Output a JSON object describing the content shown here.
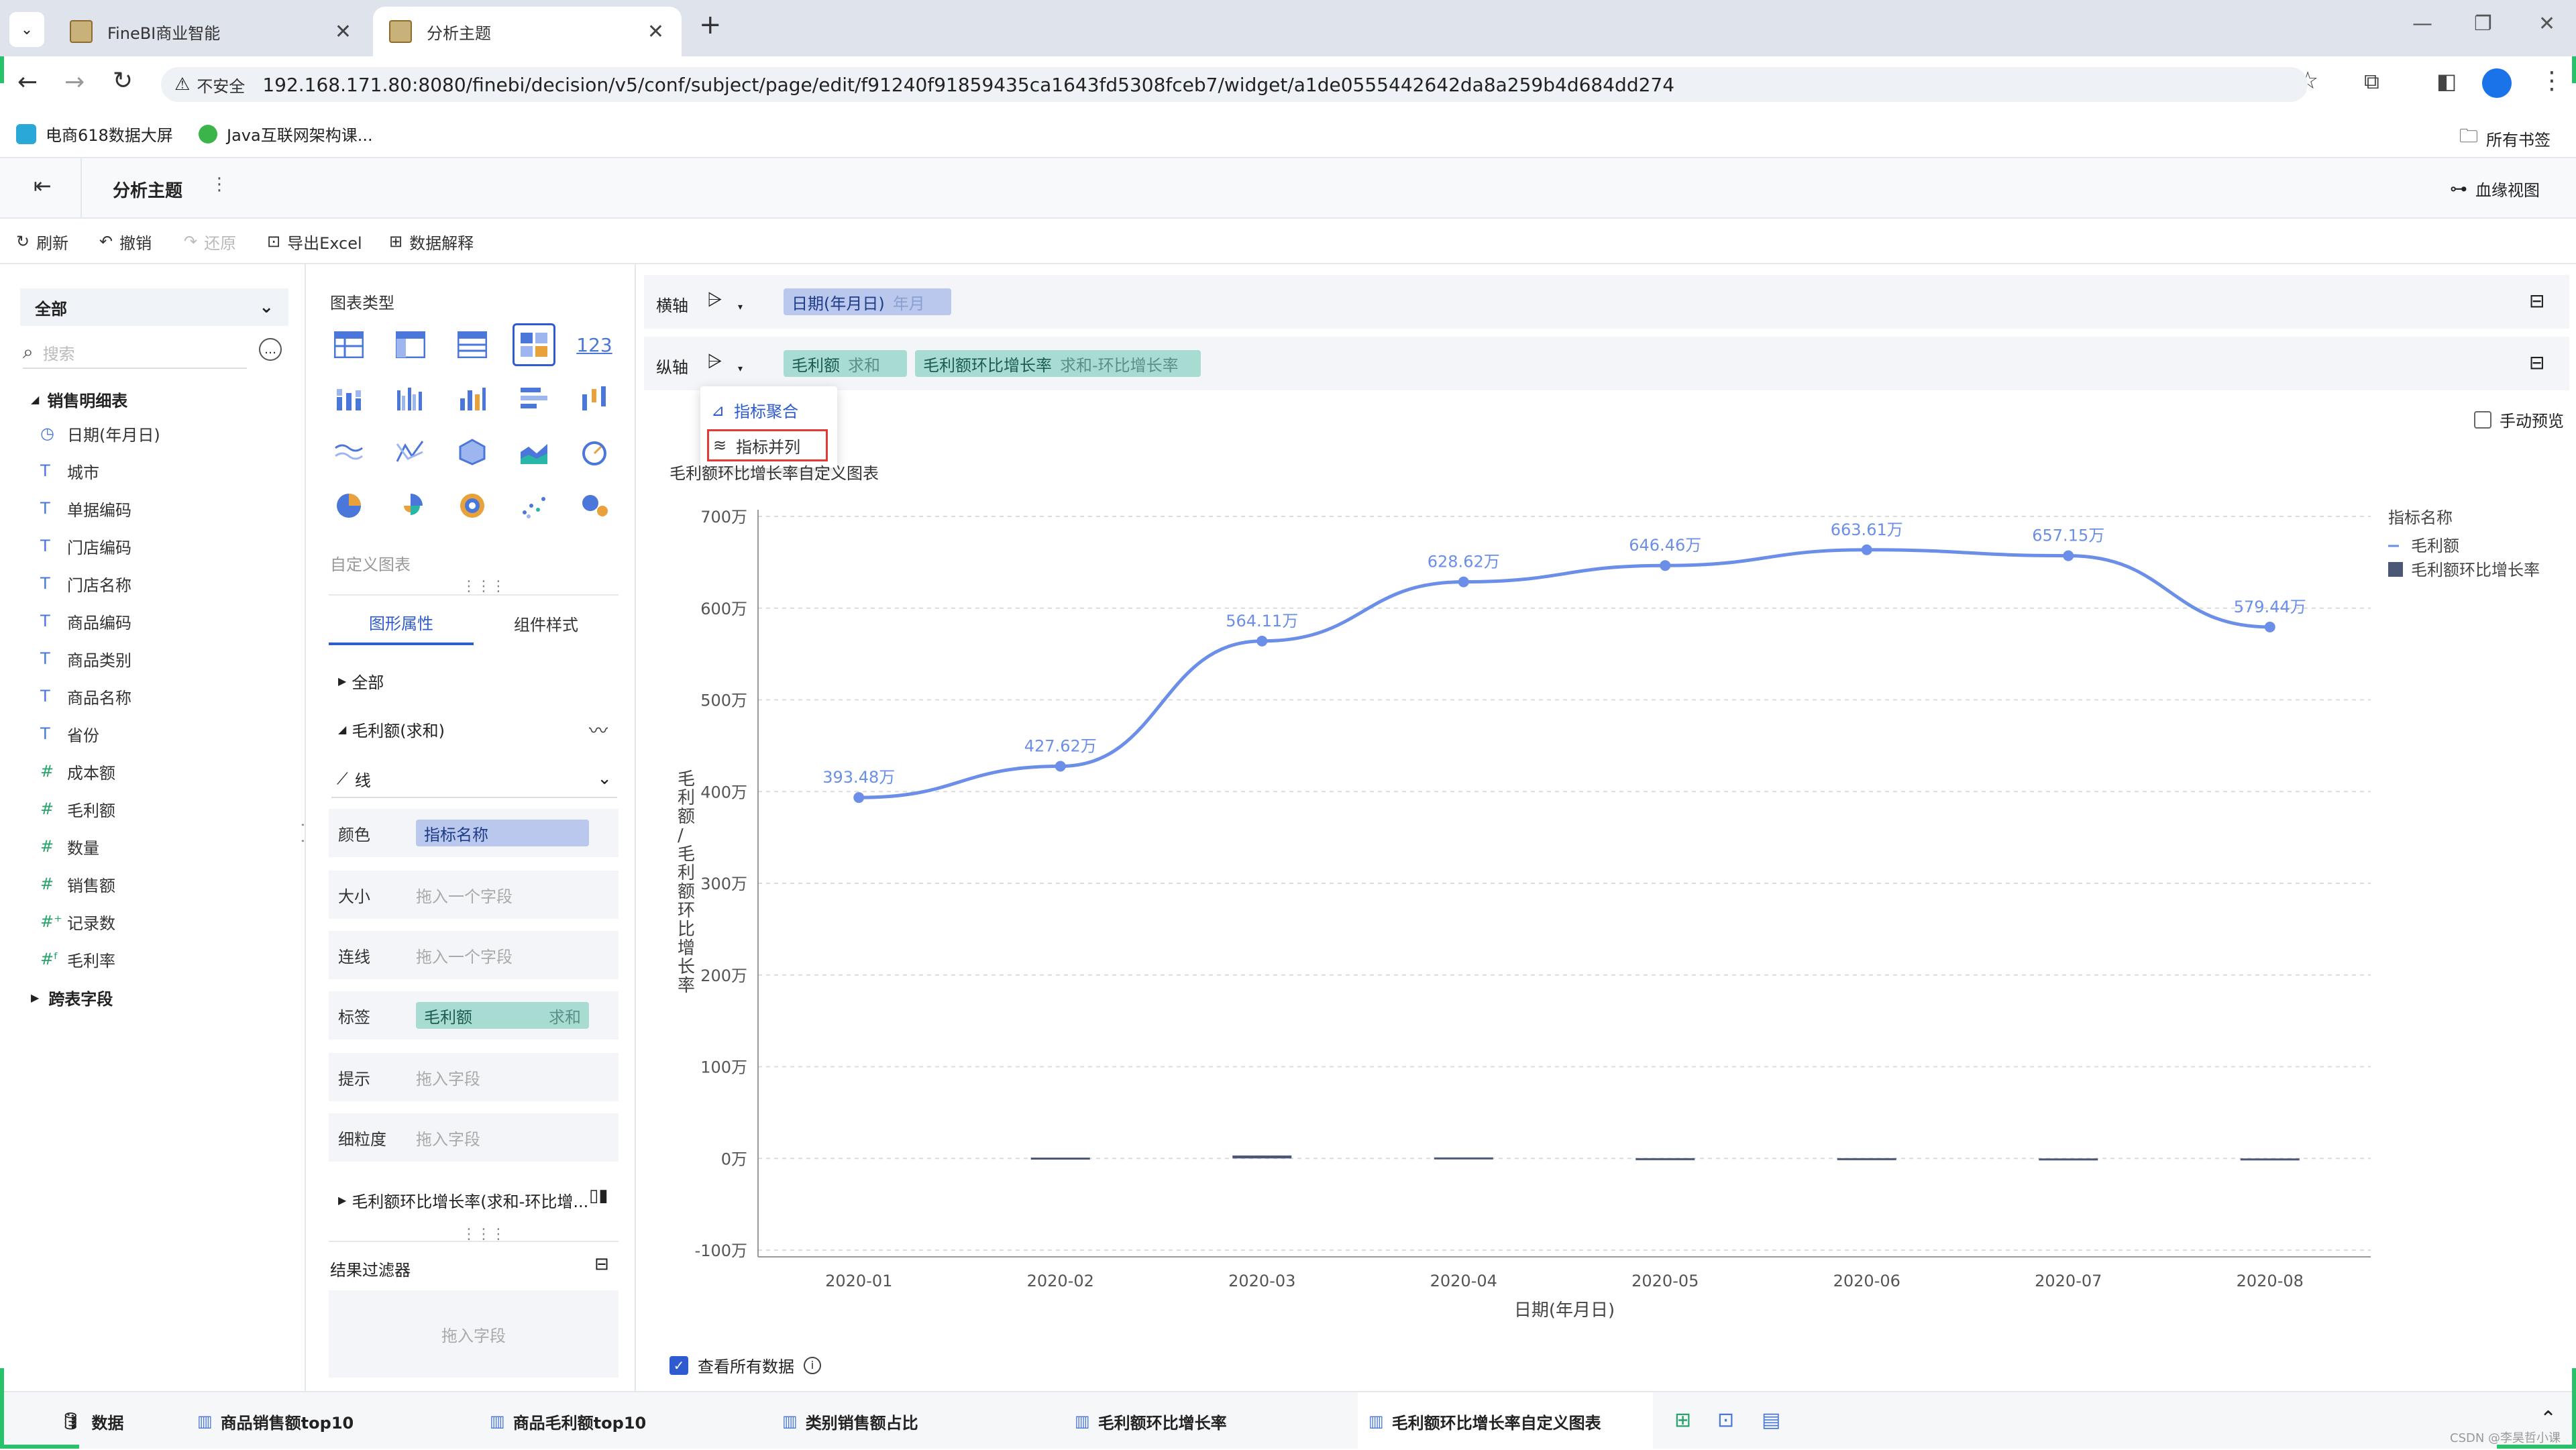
{
  "browser": {
    "tabs": [
      {
        "title": "FineBI商业智能"
      },
      {
        "title": "分析主题"
      }
    ],
    "new_tab": "+",
    "url_security": "不安全",
    "url": "192.168.171.80:8080/finebi/decision/v5/conf/subject/page/edit/f91240f91859435ca1643fd5308fceb7/widget/a1de0555442642da8a259b4d684dd274",
    "bookmarks": [
      "电商618数据大屏",
      "Java互联网架构课..."
    ],
    "all_bookmarks": "所有书签"
  },
  "app": {
    "title": "分析主题",
    "lineage": "血缘视图",
    "toolbar": [
      "刷新",
      "撤销",
      "还原",
      "导出Excel",
      "数据解释"
    ]
  },
  "data_panel": {
    "scope": "全部",
    "search_placeholder": "搜索",
    "table_name": "销售明细表",
    "fields": [
      {
        "label": "日期(年月日)",
        "icon": "clock-icon"
      },
      {
        "label": "城市",
        "icon": "T"
      },
      {
        "label": "单据编码",
        "icon": "T"
      },
      {
        "label": "门店编码",
        "icon": "T"
      },
      {
        "label": "门店名称",
        "icon": "T"
      },
      {
        "label": "商品编码",
        "icon": "T"
      },
      {
        "label": "商品类别",
        "icon": "T"
      },
      {
        "label": "商品名称",
        "icon": "T"
      },
      {
        "label": "省份",
        "icon": "T"
      },
      {
        "label": "成本额",
        "icon": "#"
      },
      {
        "label": "毛利额",
        "icon": "#"
      },
      {
        "label": "数量",
        "icon": "#"
      },
      {
        "label": "销售额",
        "icon": "#"
      },
      {
        "label": "记录数",
        "icon": "#+"
      },
      {
        "label": "毛利率",
        "icon": "#%"
      }
    ],
    "cross_table": "跨表字段"
  },
  "config_panel": {
    "chart_type_label": "图表类型",
    "number_chart_text": "123",
    "custom_chart": "自定义图表",
    "tabs": [
      "图形属性",
      "组件样式"
    ],
    "all": "全部",
    "measure1": "毛利额(求和)",
    "mark_type": "线",
    "props": [
      {
        "label": "颜色",
        "value": "指标名称",
        "extra": ""
      },
      {
        "label": "大小",
        "value": "拖入一个字段",
        "extra": ""
      },
      {
        "label": "连线",
        "value": "拖入一个字段",
        "extra": ""
      },
      {
        "label": "标签",
        "value": "毛利额",
        "extra": "求和"
      },
      {
        "label": "提示",
        "value": "拖入字段",
        "extra": ""
      },
      {
        "label": "细粒度",
        "value": "拖入字段",
        "extra": ""
      }
    ],
    "measure2": "毛利额环比增长率(求和-环比增...",
    "filter_label": "结果过滤器",
    "filter_drop": "拖入字段"
  },
  "axes": {
    "x_label": "横轴",
    "x_field": "日期(年月日)",
    "x_field_sub": "年月",
    "y_label": "纵轴",
    "y_field1": "毛利额",
    "y_field1_sub": "求和",
    "y_field2": "毛利额环比增长率",
    "y_field2_sub": "求和-环比增长率",
    "dropdown": [
      "指标聚合",
      "指标并列"
    ],
    "manual_preview": "手动预览"
  },
  "chart_title": "毛利额环比增长率自定义图表",
  "view_all": "查看所有数据",
  "chart_data": {
    "type": "line",
    "title": "毛利额环比增长率自定义图表",
    "xlabel": "日期(年月日)",
    "ylabel": "毛利额/毛利额环比增长率",
    "categories": [
      "2020-01",
      "2020-02",
      "2020-03",
      "2020-04",
      "2020-05",
      "2020-06",
      "2020-07",
      "2020-08"
    ],
    "yticks": [
      "700万",
      "600万",
      "500万",
      "400万",
      "300万",
      "200万",
      "100万",
      "0万",
      "-100万"
    ],
    "ylim": [
      -100,
      700
    ],
    "unit": "万",
    "legend_title": "指标名称",
    "series": [
      {
        "name": "毛利额",
        "type": "line",
        "color": "#6b8ee8",
        "values": [
          393.48,
          427.62,
          564.11,
          628.62,
          646.46,
          663.61,
          657.15,
          579.44
        ],
        "labels": [
          "393.48万",
          "427.62万",
          "564.11万",
          "628.62万",
          "646.46万",
          "663.61万",
          "657.15万",
          "579.44万"
        ]
      },
      {
        "name": "毛利额环比增长率",
        "type": "bar",
        "color": "#4a5876",
        "values": [
          0,
          0.09,
          0.32,
          0.11,
          0.03,
          0.03,
          -0.01,
          -0.12
        ]
      }
    ],
    "grid": true,
    "legend_position": "right"
  },
  "bottom_tabs": [
    "数据",
    "商品销售额top10",
    "商品毛利额top10",
    "类别销售额占比",
    "毛利额环比增长率",
    "毛利额环比增长率自定义图表"
  ],
  "watermark": "CSDN @李昊哲小课"
}
